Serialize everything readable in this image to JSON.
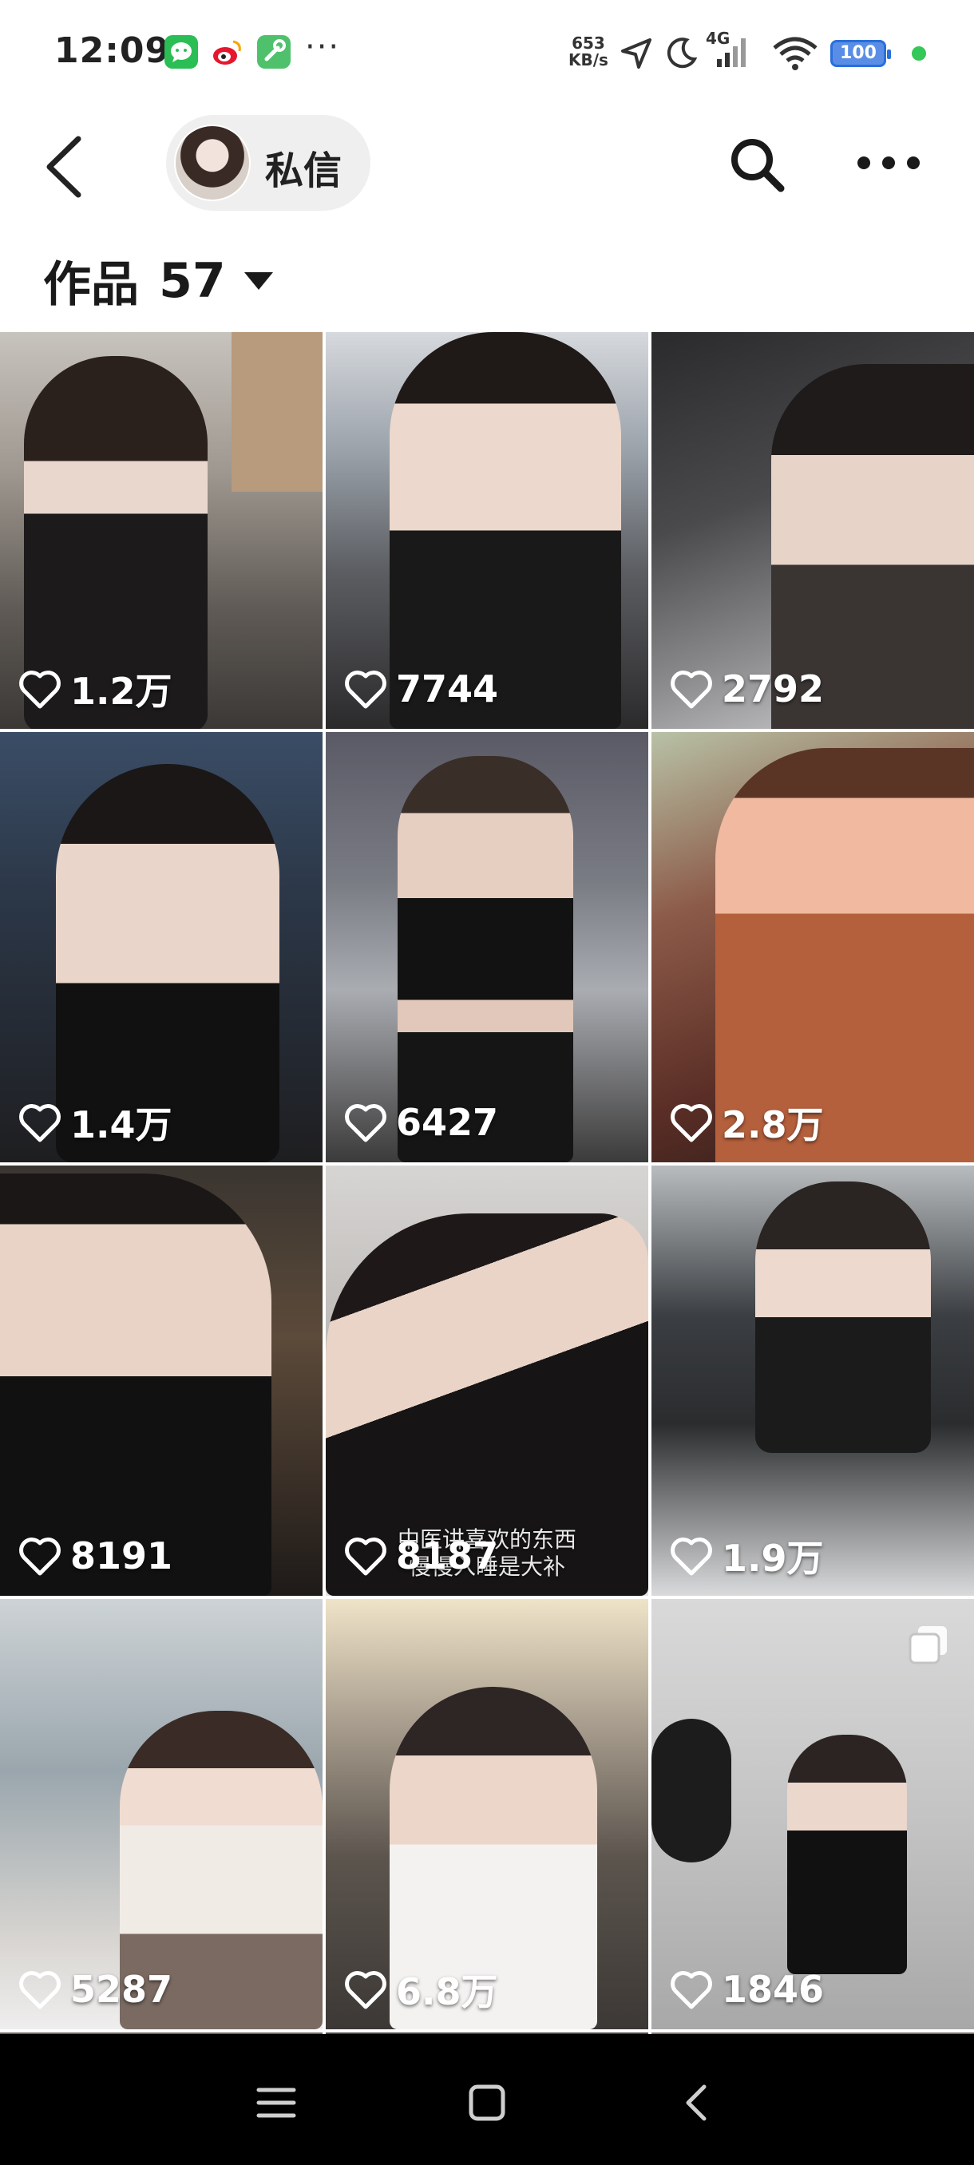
{
  "status_bar": {
    "time": "12:09",
    "dots": "···",
    "speed_value": "653",
    "speed_unit": "KB/s",
    "network": "4G",
    "battery": "100"
  },
  "header": {
    "dm_label": "私信"
  },
  "works": {
    "title": "作品",
    "count": "57"
  },
  "tiles": [
    {
      "likes": "1.2万",
      "subtitle": ""
    },
    {
      "likes": "7744",
      "subtitle": ""
    },
    {
      "likes": "2792",
      "subtitle": ""
    },
    {
      "likes": "1.4万",
      "subtitle": ""
    },
    {
      "likes": "6427",
      "subtitle": ""
    },
    {
      "likes": "2.8万",
      "subtitle": ""
    },
    {
      "likes": "8191",
      "subtitle": ""
    },
    {
      "likes": "8187",
      "subtitle": "中医讲喜欢的东西\n慢慢入睡是大补"
    },
    {
      "likes": "1.9万",
      "subtitle": ""
    },
    {
      "likes": "5287",
      "subtitle": ""
    },
    {
      "likes": "6.8万",
      "subtitle": ""
    },
    {
      "likes": "1846",
      "subtitle": ""
    }
  ],
  "colors": {
    "battery": "#2a6fdb",
    "online_dot": "#34c759",
    "nav_bar": "#000000"
  },
  "icons": [
    "back-arrow-icon",
    "search-icon",
    "more-icon",
    "heart-icon",
    "multi-image-icon",
    "menu-icon",
    "home-square-icon",
    "back-triangle-icon"
  ]
}
